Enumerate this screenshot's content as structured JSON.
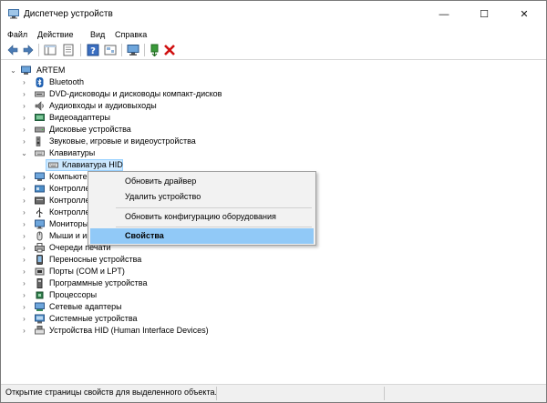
{
  "window": {
    "title": "Диспетчер устройств",
    "minimize_glyph": "—",
    "maximize_glyph": "☐",
    "close_glyph": "✕"
  },
  "menubar": {
    "items": [
      "Файл",
      "Действие",
      "Вид",
      "Справка"
    ]
  },
  "toolbar": {
    "buttons": [
      "back-icon",
      "forward-icon",
      "properties-icon",
      "console-tree-icon",
      "help-icon",
      "show-hidden-icon",
      "monitor-icon",
      "update-driver-icon",
      "uninstall-icon"
    ]
  },
  "tree": {
    "root": "ARTEM",
    "categories": [
      {
        "label": "Bluetooth",
        "icon": "bluetooth-icon"
      },
      {
        "label": "DVD-дисководы и дисководы компакт-дисков",
        "icon": "dvd-icon"
      },
      {
        "label": "Аудиовходы и аудиовыходы",
        "icon": "speaker-icon"
      },
      {
        "label": "Видеоадаптеры",
        "icon": "display-adapter-icon"
      },
      {
        "label": "Дисковые устройства",
        "icon": "disk-icon"
      },
      {
        "label": "Звуковые, игровые и видеоустройства",
        "icon": "sound-icon"
      },
      {
        "label": "Клавиатуры",
        "icon": "keyboard-icon",
        "expanded": true,
        "children": [
          "Клавиатура HID"
        ]
      },
      {
        "label": "Компьютер",
        "icon": "computer-icon"
      },
      {
        "label": "Контроллеры",
        "icon": "controller-icon"
      },
      {
        "label": "Контроллеры",
        "icon": "controller-icon"
      },
      {
        "label": "Контроллеры",
        "icon": "usb-icon"
      },
      {
        "label": "Мониторы",
        "icon": "monitor-icon"
      },
      {
        "label": "Мыши и иные",
        "icon": "mouse-icon"
      },
      {
        "label": "Очереди печати",
        "icon": "printer-icon"
      },
      {
        "label": "Переносные устройства",
        "icon": "portable-icon"
      },
      {
        "label": "Порты (COM и LPT)",
        "icon": "port-icon"
      },
      {
        "label": "Программные устройства",
        "icon": "software-device-icon"
      },
      {
        "label": "Процессоры",
        "icon": "processor-icon"
      },
      {
        "label": "Сетевые адаптеры",
        "icon": "network-icon"
      },
      {
        "label": "Системные устройства",
        "icon": "system-icon"
      },
      {
        "label": "Устройства HID (Human Interface Devices)",
        "icon": "hid-icon"
      }
    ]
  },
  "context_menu": {
    "items": [
      {
        "label": "Обновить драйвер"
      },
      {
        "label": "Удалить устройство"
      },
      {
        "label": "Обновить конфигурацию оборудования"
      },
      {
        "label": "Свойства",
        "selected": true
      }
    ]
  },
  "statusbar": {
    "text": "Открытие страницы свойств для выделенного объекта."
  },
  "colors": {
    "selection": "#cce8ff",
    "menu_highlight": "#91c9f7",
    "uninstall_red": "#d01010"
  }
}
